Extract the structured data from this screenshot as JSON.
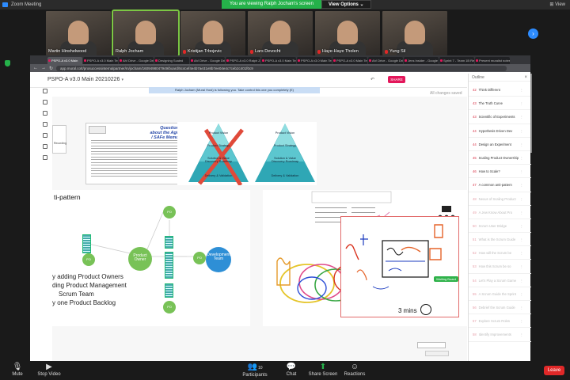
{
  "zoom": {
    "window_title": "Zoom Meeting",
    "share_banner": "You are viewing Ralph Jocham's screen",
    "view_options": "View Options",
    "view_label": "View",
    "colors": {
      "accent": "#2d8cff",
      "green": "#25b24a",
      "leave": "#e02828"
    }
  },
  "participants": [
    {
      "name": "Martin Hinshelwood",
      "muted": false
    },
    {
      "name": "Ralph Jocham",
      "muted": false
    },
    {
      "name": "Kristijan Trbojevic",
      "muted": true
    },
    {
      "name": "Lars Devocht",
      "muted": true
    },
    {
      "name": "Haye-Haye Tholen",
      "muted": true
    },
    {
      "name": "Yung Sil",
      "muted": true
    }
  ],
  "browser": {
    "tabs": [
      "PSPO-A v3.0 Main",
      "PSPO-A v3.0 Main Tem",
      "Ah! Drive - Google Drive",
      "Designing Scaled",
      "Ah! Drive - Google Drive",
      "PSPO-A v3.0 Ralph Zoom",
      "PSPO-A v3.0 Main Tem",
      "PSPO-A v3.0 Main Tem",
      "PSPO-A v3.0 Main Tem",
      "Ah! Drive - Google Drive",
      "Jens Insider - Google Drive",
      "Sprint 7 - Team 1B Retr",
      "Present muralist notes"
    ],
    "url": "app.mural.co/t/prosuccessinternalpartner/m/jocham/1609498047949/board/5c4cef4e4b7ae31e8b7ee04e4c7ceb2c401f0c9"
  },
  "mural": {
    "board_title": "PSPO-A v3.0 Main 20210226",
    "share_label": "SHARE",
    "follow_banner": "Ralph Jocham (Mural Host) is following you. Take control this one you completely (E)",
    "saved_status": "All changes saved",
    "outline_title": "Outline",
    "outline_items": [
      {
        "num": "42",
        "label": "Think Different"
      },
      {
        "num": "43",
        "label": "The Truth Curve"
      },
      {
        "num": "43",
        "label": "Scientific of Experiments"
      },
      {
        "num": "44",
        "label": "Hypothesis Driven Dev"
      },
      {
        "num": "44",
        "label": "Design an Experiment"
      },
      {
        "num": "45",
        "label": "Scaling Product Ownership"
      },
      {
        "num": "46",
        "label": "How to Scale?"
      },
      {
        "num": "47",
        "label": "A common anti-pattern"
      },
      {
        "num": "48",
        "label": "Nexus of Scaling Product"
      },
      {
        "num": "49",
        "label": "A Jew Know About Pro"
      },
      {
        "num": "50",
        "label": "Scrum User Bridge"
      },
      {
        "num": "51",
        "label": "What is the Scrum Guide"
      },
      {
        "num": "52",
        "label": "How will the Scrum be"
      },
      {
        "num": "53",
        "label": "How this Scrum be so"
      },
      {
        "num": "54",
        "label": "Let's Play a Scrum Game"
      },
      {
        "num": "55",
        "label": "A Scrum Guide the Sprint"
      },
      {
        "num": "56",
        "label": "Debrief the Scrum Guide"
      },
      {
        "num": "57",
        "label": "Explore Scrum Roles"
      },
      {
        "num": "58",
        "label": "Identify Improvements"
      }
    ],
    "slides": {
      "pdf_title": "Questions about the Agile / SAFe Memo?",
      "side_doc_label": "Recording",
      "pyramid_left": [
        "Product Vision",
        "Product Strategy",
        "Solution & Value Discovery Roadmap",
        "Delivery & Validation"
      ],
      "pyramid_right": [
        "Product Vision",
        "Product Strategy",
        "Solution & Value Discovery Roadmap",
        "Delivery & Validation"
      ],
      "anti_pattern_title": "ti-pattern",
      "po_label": "PO",
      "product_owner_label": "Product Owner",
      "dev_team_label": "Development Team",
      "bullets": [
        "y adding Product Owners",
        "ding Product Management",
        "Scrum Team",
        "y one Product Backlog"
      ],
      "timer": "3 mins",
      "waiting_badge": "Waiting Board"
    }
  },
  "controls": {
    "mute": "Mute",
    "stop_video": "Stop Video",
    "participants": "Participants",
    "participants_count": "10",
    "chat": "Chat",
    "share_screen": "Share Screen",
    "reactions": "Reactions",
    "leave": "Leave"
  }
}
